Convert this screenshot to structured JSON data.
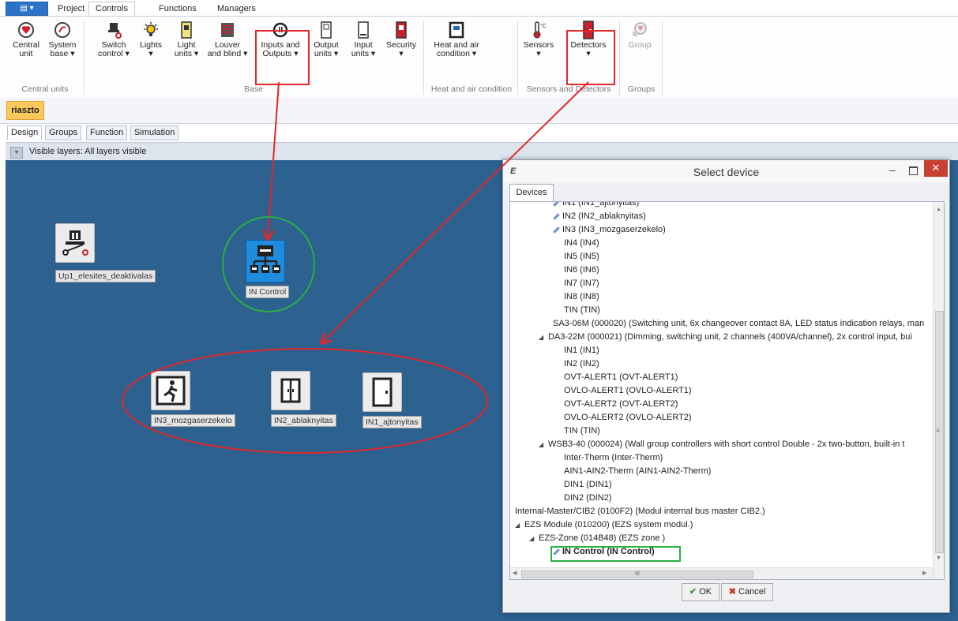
{
  "menu": {
    "app_button": "▤ ▾",
    "tabs": [
      "Project",
      "Controls",
      "Functions",
      "Managers"
    ],
    "active_tab": "Controls"
  },
  "ribbon": {
    "buttons": [
      {
        "id": "central-unit",
        "label_1": "Central",
        "label_2": "unit"
      },
      {
        "id": "system-base",
        "label_1": "System",
        "label_2": "base ▾"
      },
      {
        "id": "switch-control",
        "label_1": "Switch",
        "label_2": "control ▾"
      },
      {
        "id": "lights",
        "label_1": "Lights",
        "label_2": "▾"
      },
      {
        "id": "light-units",
        "label_1": "Light",
        "label_2": "units ▾"
      },
      {
        "id": "louver-blind",
        "label_1": "Louver",
        "label_2": "and blind ▾"
      },
      {
        "id": "inputs-outputs",
        "label_1": "Inputs and",
        "label_2": "Outputs ▾"
      },
      {
        "id": "output-units",
        "label_1": "Output",
        "label_2": "units ▾"
      },
      {
        "id": "input-units",
        "label_1": "Input",
        "label_2": "units ▾"
      },
      {
        "id": "security",
        "label_1": "Security",
        "label_2": "▾"
      },
      {
        "id": "heat-air",
        "label_1": "Heat and air",
        "label_2": "condition ▾"
      },
      {
        "id": "sensors",
        "label_1": "Sensors",
        "label_2": "▾"
      },
      {
        "id": "detectors",
        "label_1": "Detectors",
        "label_2": "▾"
      },
      {
        "id": "group",
        "label_1": "Group",
        "label_2": ""
      }
    ],
    "groups": [
      "Central units",
      "Base",
      "Heat and air condition",
      "Sensors and Detectors",
      "Groups"
    ]
  },
  "doc_tab": "riaszto",
  "view_tabs": [
    "Design",
    "Groups",
    "Function",
    "Simulation"
  ],
  "active_view": "Design",
  "layers_text": "Visible layers: All layers visible",
  "canvas": {
    "devices": [
      "Up1_elesites_deaktivalas",
      "IN Control",
      "IN3_mozgaserzekelo",
      "IN2_ablaknyitas",
      "IN1_ajtonyitas"
    ]
  },
  "dialog": {
    "title": "Select device",
    "logo": "E",
    "tab": "Devices",
    "tree": [
      {
        "text": "IN1 (IN1_ajtonyitas)",
        "pencil": true
      },
      {
        "text": "IN2 (IN2_ablaknyitas)",
        "pencil": true
      },
      {
        "text": "IN3 (IN3_mozgaserzekelo)",
        "pencil": true
      },
      {
        "text": "IN4 (IN4)"
      },
      {
        "text": "IN5 (IN5)"
      },
      {
        "text": "IN6 (IN6)"
      },
      {
        "text": "IN7 (IN7)"
      },
      {
        "text": "IN8 (IN8)"
      },
      {
        "text": "TIN (TIN)"
      },
      {
        "text": "SA3-06M (000020) (Switching unit, 6x changeover contact 8A, LED status indication relays, man"
      },
      {
        "text": "DA3-22M (000021) (Dimming, switching unit, 2 channels (400VA/channel), 2x control input, bui",
        "arrow": "◢"
      },
      {
        "text": "IN1 (IN1)"
      },
      {
        "text": "IN2 (IN2)"
      },
      {
        "text": "OVT-ALERT1 (OVT-ALERT1)"
      },
      {
        "text": "OVLO-ALERT1 (OVLO-ALERT1)"
      },
      {
        "text": "OVT-ALERT2 (OVT-ALERT2)"
      },
      {
        "text": "OVLO-ALERT2 (OVLO-ALERT2)"
      },
      {
        "text": "TIN (TIN)"
      },
      {
        "text": "WSB3-40 (000024) (Wall group controllers with short control Double - 2x two-button, built-in t",
        "arrow": "◢"
      },
      {
        "text": "Inter-Therm (Inter-Therm)"
      },
      {
        "text": "AIN1-AIN2-Therm (AIN1-AIN2-Therm)"
      },
      {
        "text": "DIN1 (DIN1)"
      },
      {
        "text": "DIN2 (DIN2)"
      },
      {
        "text": "Internal-Master/CIB2 (0100F2) (Modul internal bus master CIB2.)"
      },
      {
        "text": "EZS Module (010200) (EZS system modul.)",
        "arrow": "◢"
      },
      {
        "text": "EZS-Zone (014B48) (EZS zone )",
        "arrow": "◢"
      },
      {
        "text": "IN Control (IN Control)",
        "pencil": true,
        "bold": true
      }
    ],
    "hscroll_mark": "III",
    "ok_label": "OK",
    "cancel_label": "Cancel"
  },
  "colors": {
    "canvas": "#2c6190",
    "annotation_red": "#e0282a",
    "annotation_green": "#28b040",
    "close_button": "#c84031",
    "doc_tab": "#fbc85c"
  }
}
